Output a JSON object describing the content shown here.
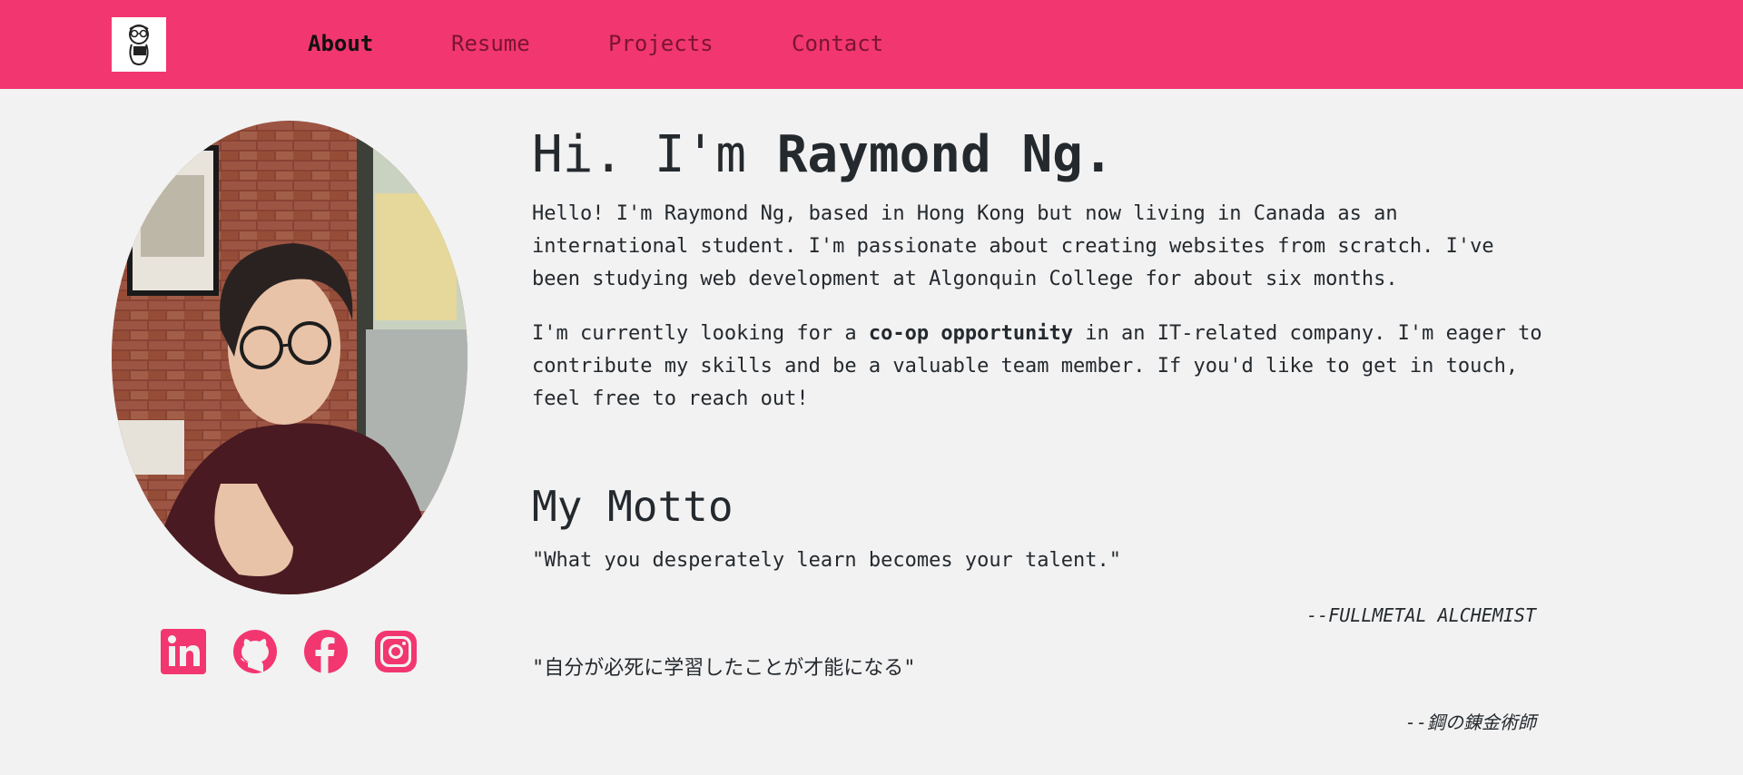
{
  "nav": {
    "logo_alt": "logo",
    "items": [
      {
        "label": "About"
      },
      {
        "label": "Resume"
      },
      {
        "label": "Projects"
      },
      {
        "label": "Contact"
      }
    ]
  },
  "hero": {
    "title_prefix": "Hi. I'm ",
    "title_name": "Raymond Ng.",
    "intro": "Hello! I'm Raymond Ng, based in Hong Kong but now living in Canada as an international student. I'm passionate about creating websites from scratch. I've been studying web development at Algonquin College for about six months.",
    "coop_before": "I'm currently looking for a ",
    "coop_bold": "co-op opportunity",
    "coop_after": " in an IT-related company. I'm eager to contribute my skills and be a valuable team member. If you'd like to get in touch, feel free to reach out!"
  },
  "motto": {
    "title": "My Motto",
    "quote_en": "\"What you desperately learn becomes your talent.\"",
    "attrib_en": "--FULLMETAL ALCHEMIST",
    "quote_jp": "\"自分が必死に学習したことが才能になる\"",
    "attrib_jp": "--鋼の錬金術師"
  },
  "social": [
    {
      "icon": "linkedin-icon"
    },
    {
      "icon": "github-icon"
    },
    {
      "icon": "facebook-icon"
    },
    {
      "icon": "instagram-icon"
    }
  ],
  "colors": {
    "accent": "#f23670",
    "background": "#f2f2f2",
    "text": "#24292e"
  }
}
